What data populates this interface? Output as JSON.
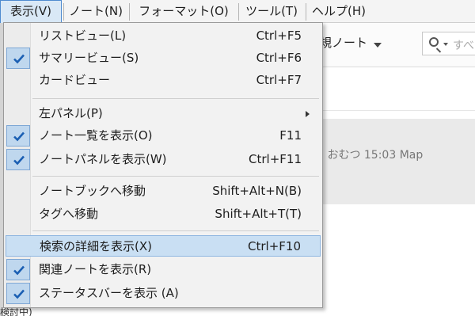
{
  "menubar": {
    "items": [
      {
        "label": "表示(V)",
        "active": true
      },
      {
        "label": "ノート(N)",
        "active": false
      },
      {
        "label": "フォーマット(O)",
        "active": false
      },
      {
        "label": "ツール(T)",
        "active": false
      },
      {
        "label": "ヘルプ(H)",
        "active": false
      }
    ]
  },
  "toolbar": {
    "new_note_label": "規ノート",
    "search_placeholder": "すべ"
  },
  "note_list": {
    "meta_text": "》 おむつ 15:03 Map"
  },
  "status_fragment": "検討中)",
  "view_menu": {
    "items": [
      {
        "label": "リストビュー(L)",
        "shortcut": "Ctrl+F5",
        "checked": false
      },
      {
        "label": "サマリービュー(S)",
        "shortcut": "Ctrl+F6",
        "checked": true
      },
      {
        "label": "カードビュー",
        "shortcut": "Ctrl+F7",
        "checked": false
      },
      {
        "label": "左パネル(P)",
        "shortcut": "",
        "checked": false,
        "submenu": true
      },
      {
        "label": "ノート一覧を表示(O)",
        "shortcut": "F11",
        "checked": true
      },
      {
        "label": "ノートパネルを表示(W)",
        "shortcut": "Ctrl+F11",
        "checked": true
      },
      {
        "label": "ノートブックへ移動",
        "shortcut": "Shift+Alt+N(B)",
        "checked": false
      },
      {
        "label": "タグへ移動",
        "shortcut": "Shift+Alt+T(T)",
        "checked": false
      },
      {
        "label": "検索の詳細を表示(X)",
        "shortcut": "Ctrl+F10",
        "checked": false,
        "highlighted": true
      },
      {
        "label": "関連ノートを表示(R)",
        "shortcut": "",
        "checked": true
      },
      {
        "label": "ステータスバーを表示 (A)",
        "shortcut": "",
        "checked": true
      }
    ]
  },
  "colors": {
    "highlight": "#c9dff3",
    "check_bg": "#bfd7ee",
    "check_mark": "#1b5fb3",
    "menu_bg": "#f2f2f2"
  }
}
